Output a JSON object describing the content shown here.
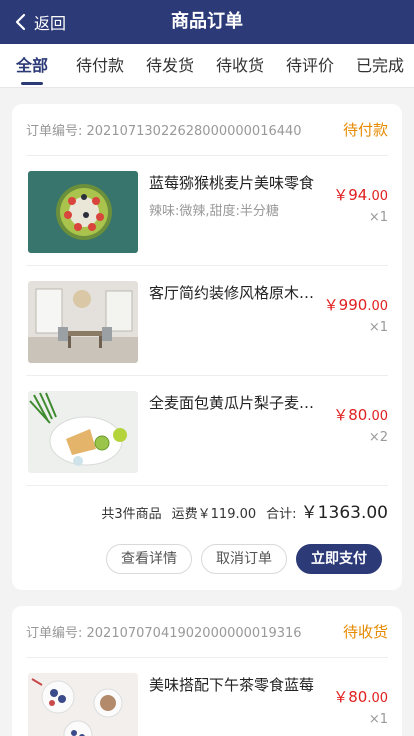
{
  "nav": {
    "back_label": "返回",
    "title": "商品订单"
  },
  "tabs": [
    {
      "label": "全部",
      "active": true
    },
    {
      "label": "待付款",
      "active": false
    },
    {
      "label": "待发货",
      "active": false
    },
    {
      "label": "待收货",
      "active": false
    },
    {
      "label": "待评价",
      "active": false
    },
    {
      "label": "已完成",
      "active": false
    }
  ],
  "orders": [
    {
      "order_no_label": "订单编号: 20210713022628000000016440",
      "status": "待付款",
      "items": [
        {
          "name": "蓝莓猕猴桃麦片美味零食",
          "spec": "辣味:微辣,甜度:半分糖",
          "currency": "￥",
          "price_int": "94",
          "price_dec": ".00",
          "qty": "×1",
          "image": "fruit-bowl"
        },
        {
          "name": "客厅简约装修风格原木家具",
          "spec": "",
          "currency": "￥",
          "price_int": "990",
          "price_dec": ".00",
          "qty": "×1",
          "image": "living-room"
        },
        {
          "name": "全麦面包黄瓜片梨子麦片早餐",
          "spec": "",
          "currency": "￥",
          "price_int": "80",
          "price_dec": ".00",
          "qty": "×2",
          "image": "breakfast-plate"
        }
      ],
      "count_text": "共3件商品",
      "shipping_text": "运费￥119.00",
      "total_label": "合计:",
      "total_value": "￥1363.00",
      "actions": {
        "detail": "查看详情",
        "cancel": "取消订单",
        "pay": "立即支付"
      }
    },
    {
      "order_no_label": "订单编号: 20210707041902000000019316",
      "status": "待收货",
      "items": [
        {
          "name": "美味搭配下午茶零食蓝莓",
          "spec": "",
          "currency": "￥",
          "price_int": "80",
          "price_dec": ".00",
          "qty": "×1",
          "image": "afternoon-tea"
        }
      ]
    }
  ],
  "colors": {
    "brand": "#2c3a78",
    "price": "#e02020",
    "status": "#e68a00"
  }
}
